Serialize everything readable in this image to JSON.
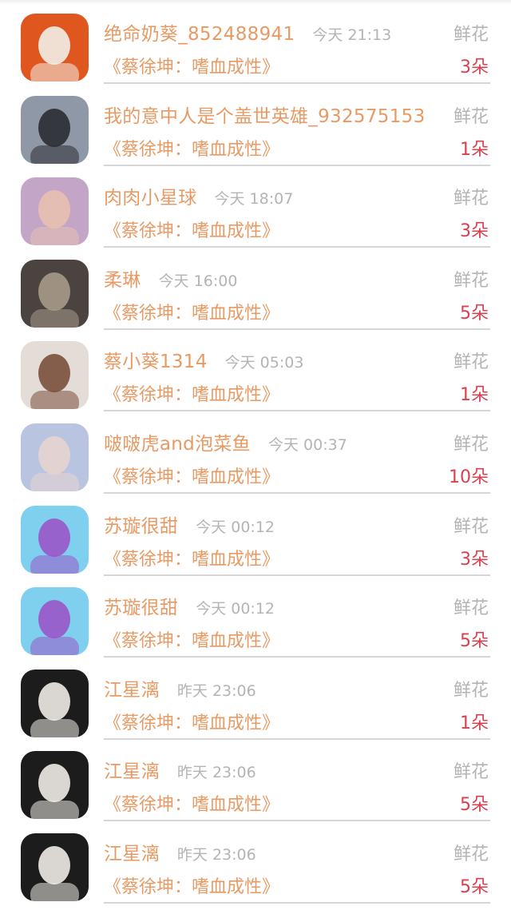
{
  "rows": [
    {
      "name": "绝命奶葵_852488941",
      "time": "今天 21:13",
      "gift": "鲜花",
      "book": "《蔡徐坤：嗜血成性》",
      "count": "3朵",
      "avatar": "cartoon-girl-avatar",
      "colors": [
        "#e0561f",
        "#f2f0e8"
      ]
    },
    {
      "name": "我的意中人是个盖世英雄_932575153",
      "time": "",
      "gift": "鲜花",
      "book": "《蔡徐坤：嗜血成性》",
      "count": "1朵",
      "avatar": "boy-photo-avatar",
      "colors": [
        "#8f98a6",
        "#2b2c33"
      ]
    },
    {
      "name": "肉肉小星球",
      "time": "今天 18:07",
      "gift": "鲜花",
      "book": "《蔡徐坤：嗜血成性》",
      "count": "3朵",
      "avatar": "girl-photo-avatar",
      "colors": [
        "#c3a5c8",
        "#e8c0b0"
      ]
    },
    {
      "name": "柔琳",
      "time": "今天 16:00",
      "gift": "鲜花",
      "book": "《蔡徐坤：嗜血成性》",
      "count": "5朵",
      "avatar": "cat-photo-avatar",
      "colors": [
        "#4a4340",
        "#a89a88"
      ]
    },
    {
      "name": "蔡小葵1314",
      "time": "今天 05:03",
      "gift": "鲜花",
      "book": "《蔡徐坤：嗜血成性》",
      "count": "1朵",
      "avatar": "boy-photo-avatar",
      "colors": [
        "#e4dcd6",
        "#7a4f3c"
      ]
    },
    {
      "name": "啵啵虎and泡菜鱼",
      "time": "今天 00:37",
      "gift": "鲜花",
      "book": "《蔡徐坤：嗜血成性》",
      "count": "10朵",
      "avatar": "couple-photo-avatar",
      "colors": [
        "#b9c5e0",
        "#e7d3cf"
      ]
    },
    {
      "name": "苏璇很甜",
      "time": "今天 00:12",
      "gift": "鲜花",
      "book": "《蔡徐坤：嗜血成性》",
      "count": "3朵",
      "avatar": "boy-photo-avatar",
      "colors": [
        "#7fd0ef",
        "#9a55c8"
      ]
    },
    {
      "name": "苏璇很甜",
      "time": "今天 00:12",
      "gift": "鲜花",
      "book": "《蔡徐坤：嗜血成性》",
      "count": "5朵",
      "avatar": "boy-photo-avatar",
      "colors": [
        "#7fd0ef",
        "#9a55c8"
      ]
    },
    {
      "name": "江星漓",
      "time": "昨天 23:06",
      "gift": "鲜花",
      "book": "《蔡徐坤：嗜血成性》",
      "count": "1朵",
      "avatar": "girl-photo-avatar",
      "colors": [
        "#1c1c1c",
        "#f0ece8"
      ]
    },
    {
      "name": "江星漓",
      "time": "昨天 23:06",
      "gift": "鲜花",
      "book": "《蔡徐坤：嗜血成性》",
      "count": "5朵",
      "avatar": "girl-photo-avatar",
      "colors": [
        "#1c1c1c",
        "#f0ece8"
      ]
    },
    {
      "name": "江星漓",
      "time": "昨天 23:06",
      "gift": "鲜花",
      "book": "《蔡徐坤：嗜血成性》",
      "count": "5朵",
      "avatar": "girl-photo-avatar",
      "colors": [
        "#1c1c1c",
        "#f0ece8"
      ]
    }
  ],
  "colors": {
    "name": "#e89a64",
    "time": "#b4b4b4",
    "count": "#d9404f",
    "divider": "#d6d6d6"
  }
}
